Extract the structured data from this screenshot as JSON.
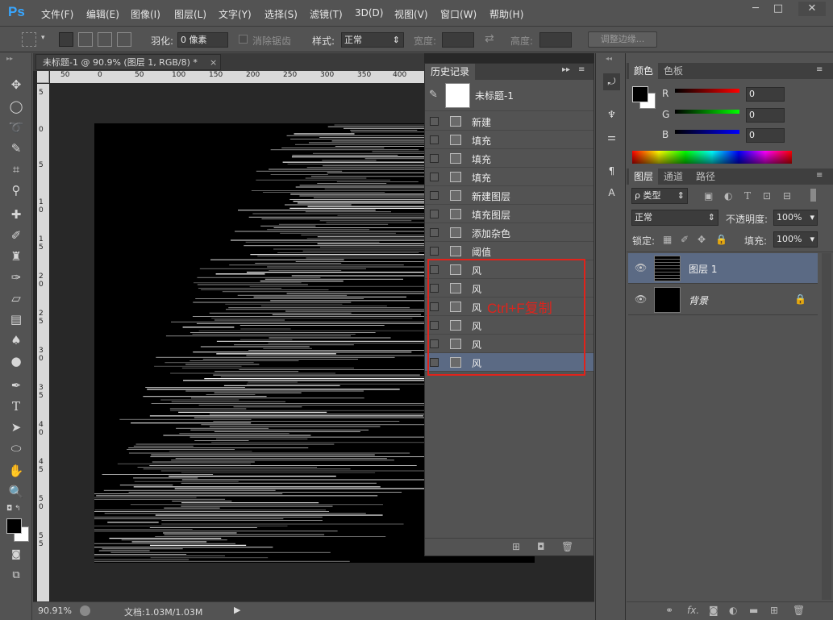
{
  "app": {
    "logo": "Ps"
  },
  "menu": [
    "文件(F)",
    "编辑(E)",
    "图像(I)",
    "图层(L)",
    "文字(Y)",
    "选择(S)",
    "滤镜(T)",
    "3D(D)",
    "视图(V)",
    "窗口(W)",
    "帮助(H)"
  ],
  "window_controls": {
    "minimize": "─",
    "maximize": "□",
    "close": "✕"
  },
  "options_bar": {
    "feather_label": "羽化:",
    "feather_value": "0 像素",
    "antialias_label": "消除锯齿",
    "style_label": "样式:",
    "style_value": "正常",
    "width_label": "宽度:",
    "height_label": "高度:",
    "refine_edge": "调整边缘..."
  },
  "document": {
    "tab_title": "未标题-1 @ 90.9% (图层 1, RGB/8) *",
    "ruler_h": [
      "50",
      "0",
      "50",
      "100",
      "150",
      "200",
      "250",
      "300",
      "350",
      "400"
    ],
    "ruler_v": [
      "5",
      "0",
      "5",
      "1 0",
      "1 5",
      "2 0",
      "2 5",
      "3 0",
      "3 5",
      "4 0",
      "4 5",
      "5 0",
      "5 5"
    ],
    "zoom": "90.91%",
    "doc_size": "文档:1.03M/1.03M"
  },
  "history": {
    "title": "历史记录",
    "snapshot": "未标题-1",
    "items": [
      "新建",
      "填充",
      "填充",
      "填充",
      "新建图层",
      "填充图层",
      "添加杂色",
      "阈值",
      "风",
      "风",
      "风",
      "风",
      "风",
      "风"
    ],
    "selected_index": 13,
    "annotation": "Ctrl+F复制",
    "annotation_color": "#e0231b"
  },
  "color_panel": {
    "tabs": [
      "颜色",
      "色板"
    ],
    "r_label": "R",
    "r_value": "0",
    "g_label": "G",
    "g_value": "0",
    "b_label": "B",
    "b_value": "0"
  },
  "layers_panel": {
    "tabs": [
      "图层",
      "通道",
      "路径"
    ],
    "filter_label": "ρ 类型",
    "blend_mode": "正常",
    "opacity_label": "不透明度:",
    "opacity_value": "100%",
    "lock_label": "锁定:",
    "fill_label": "填充:",
    "fill_value": "100%",
    "layers": [
      {
        "name": "图层 1",
        "selected": true
      },
      {
        "name": "背景",
        "selected": false
      }
    ]
  },
  "colors": {
    "accent": "#38a6ff",
    "selected_row": "#5b6a84",
    "annotation_box": "#e0231b"
  }
}
